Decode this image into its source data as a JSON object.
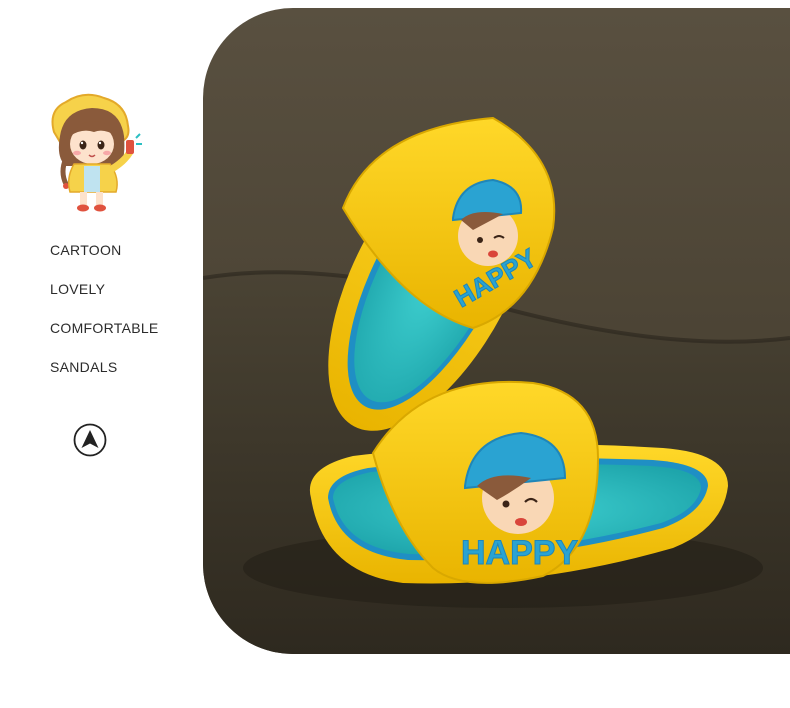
{
  "features": {
    "items": [
      "CARTOON",
      "LOVELY",
      "COMFORTABLE",
      "SANDALS"
    ]
  },
  "mascot": {
    "icon": "cartoon-girl-icon"
  },
  "navigation": {
    "icon": "navigation-arrow-icon"
  },
  "product": {
    "strap_text_back": "HAPPY",
    "strap_text_front": "HAPPY",
    "colors": {
      "sandal_yellow": "#f5c90f",
      "footbed_teal": "#2bbfc2",
      "accent_blue": "#1f8fc4",
      "background_sofa": "#4a4332"
    }
  }
}
